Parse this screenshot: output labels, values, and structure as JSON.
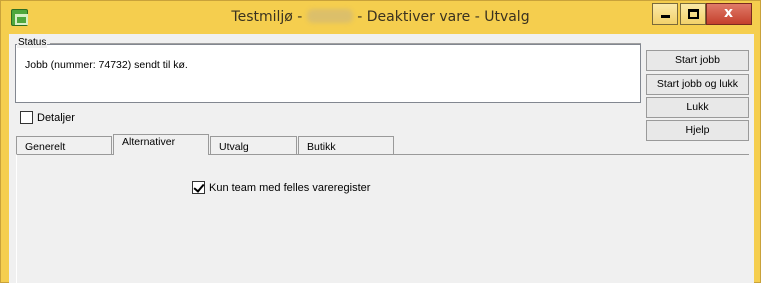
{
  "window": {
    "title_left": "Testmiljø - ",
    "title_right": " - Deaktiver vare - Utvalg",
    "icon": "app-icon",
    "controls": {
      "minimize": "minimize-icon",
      "maximize": "maximize-icon",
      "close": "x"
    }
  },
  "status": {
    "legend": "Status",
    "text": "Jobb (nummer: 74732) sendt til kø."
  },
  "buttons": {
    "start": "Start jobb",
    "start_close": "Start jobb og lukk",
    "close": "Lukk",
    "help": "Hjelp"
  },
  "detaljer": {
    "label": "Detaljer",
    "checked": false
  },
  "tabs": [
    "Generelt",
    "Alternativer",
    "Utvalg",
    "Butikk"
  ],
  "active_tab": "Alternativer",
  "panel": {
    "option_label": "Kun team med felles vareregister",
    "option_checked": true
  },
  "colors": {
    "titlebar": "#f5ce4e",
    "client": "#f0f0f0",
    "close": "#c4402c"
  }
}
